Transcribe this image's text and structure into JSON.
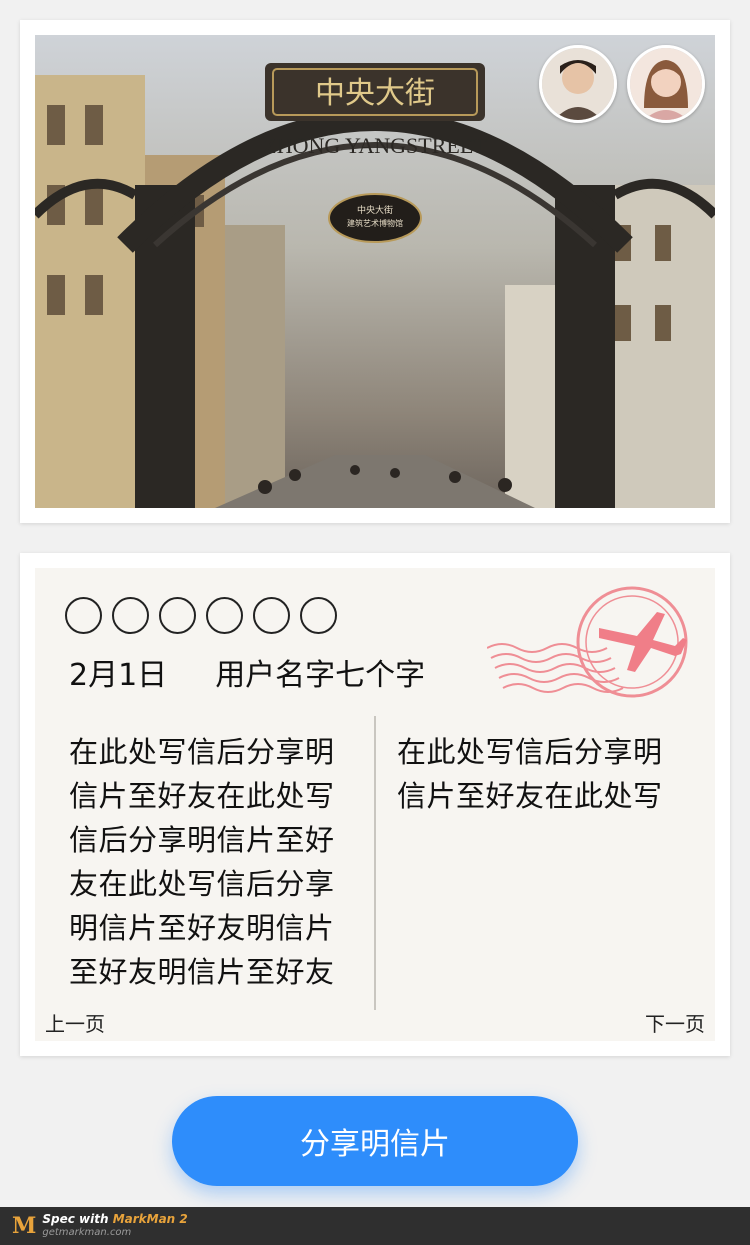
{
  "photo": {
    "gate_sign_text": "中央大街",
    "gate_sign_latin": "ZHONG YANGSTREET",
    "plaque_line1": "中央大街",
    "plaque_line2": "建筑艺术博物馆",
    "avatars": [
      {
        "icon": "avatar-male-icon",
        "color": "#7a6a5e"
      },
      {
        "icon": "avatar-female-icon",
        "color": "#c99a86"
      }
    ]
  },
  "letter": {
    "postal_code_boxes": 6,
    "date": "2月1日",
    "username": "用户名字七个字",
    "stamp_icon": "airplane-postmark-icon",
    "left_column": [
      "在此处写信后分享明",
      "信片至好友在此处写",
      "信后分享明信片至好",
      "友在此处写信后分享",
      "明信片至好友明信片",
      "至好友明信片至好友"
    ],
    "right_column": [
      "在此处写信后分享明",
      "信片至好友在此处写"
    ],
    "prev_label": "上一页",
    "next_label": "下一页"
  },
  "share_button": {
    "label": "分享明信片",
    "color": "#2e8dfb"
  },
  "footer": {
    "logo": "M",
    "spec_prefix": "Spec with ",
    "brand": "MarkMan 2",
    "site": "getmarkman.com"
  }
}
